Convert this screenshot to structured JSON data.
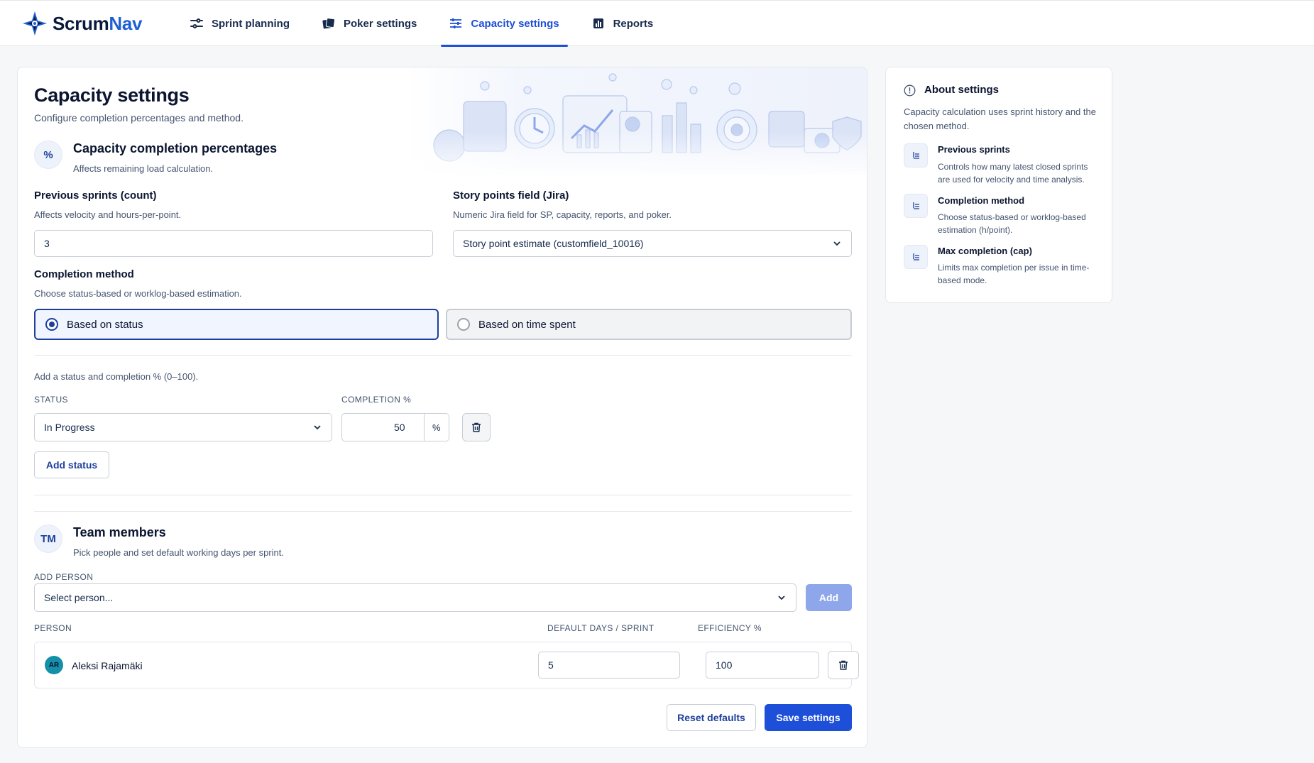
{
  "app": {
    "brand_part1": "Scrum",
    "brand_part2": "Nav"
  },
  "nav": {
    "items": [
      {
        "label": "Sprint planning",
        "icon": "planning-icon"
      },
      {
        "label": "Poker settings",
        "icon": "cards-icon"
      },
      {
        "label": "Capacity settings",
        "icon": "sliders-icon",
        "active": true
      },
      {
        "label": "Reports",
        "icon": "bar-chart-icon"
      }
    ]
  },
  "page": {
    "title": "Capacity settings",
    "subtitle": "Configure completion percentages and method."
  },
  "completion_section": {
    "badge": "%",
    "title": "Capacity completion percentages",
    "subtitle": "Affects remaining load calculation."
  },
  "previous_sprints": {
    "label": "Previous sprints (count)",
    "help": "Affects velocity and hours-per-point.",
    "value": "3"
  },
  "story_points": {
    "label": "Story points field (Jira)",
    "help": "Numeric Jira field for SP, capacity, reports, and poker.",
    "value": "Story point estimate (customfield_10016)"
  },
  "completion_method": {
    "label": "Completion method",
    "help": "Choose status-based or worklog-based estimation.",
    "options": [
      {
        "label": "Based on status",
        "selected": true
      },
      {
        "label": "Based on time spent",
        "selected": false
      }
    ]
  },
  "status_table": {
    "help": "Add a status and completion % (0–100).",
    "status_header": "STATUS",
    "completion_header": "COMPLETION %",
    "rows": [
      {
        "status": "In Progress",
        "completion": "50",
        "unit": "%"
      }
    ],
    "add_label": "Add status"
  },
  "team_section": {
    "badge": "TM",
    "title": "Team members",
    "subtitle": "Pick people and set default working days per sprint.",
    "add_person_label": "ADD PERSON",
    "select_placeholder": "Select person...",
    "add_button": "Add",
    "col_person": "PERSON",
    "col_days": "DEFAULT DAYS / SPRINT",
    "col_efficiency": "EFFICIENCY %",
    "members": [
      {
        "initials": "AR",
        "name": "Aleksi Rajamäki",
        "days": "5",
        "efficiency": "100"
      }
    ]
  },
  "actions": {
    "reset": "Reset defaults",
    "save": "Save settings"
  },
  "about": {
    "title": "About settings",
    "description": "Capacity calculation uses sprint history and the chosen method.",
    "items": [
      {
        "title": "Previous sprints",
        "desc": "Controls how many latest closed sprints are used for velocity and time analysis."
      },
      {
        "title": "Completion method",
        "desc": "Choose status-based or worklog-based estimation (h/point)."
      },
      {
        "title": "Max completion (cap)",
        "desc": "Limits max completion per issue in time-based mode."
      }
    ]
  },
  "colors": {
    "primary": "#1e4fd8",
    "brand_dark": "#0a1a3a",
    "accent_blue": "#1e3f9c",
    "avatar": "#1590a8"
  }
}
